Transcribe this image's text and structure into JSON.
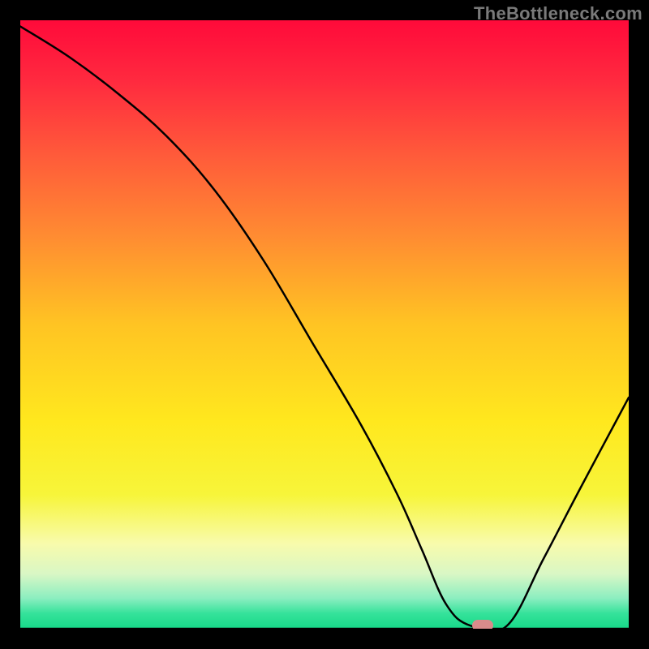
{
  "watermark": "TheBottleneck.com",
  "marker": {
    "color": "#d98b8b"
  },
  "chart_data": {
    "type": "line",
    "title": "",
    "xlabel": "",
    "ylabel": "",
    "xlim": [
      0,
      100
    ],
    "ylim": [
      0,
      100
    ],
    "grid": false,
    "series": [
      {
        "name": "bottleneck-curve",
        "x": [
          0,
          8,
          16,
          24,
          32,
          40,
          48,
          56,
          62,
          66,
          70,
          74,
          80,
          86,
          92,
          100
        ],
        "values": [
          99,
          94,
          88,
          81,
          72,
          60.5,
          47,
          33.5,
          22,
          13,
          4,
          0.5,
          0.5,
          11.5,
          23,
          38
        ]
      }
    ],
    "marker_point": {
      "x": 76,
      "y": 0.5
    },
    "background_gradient": {
      "stops": [
        {
          "offset": 0.0,
          "color": "#ff0a3a"
        },
        {
          "offset": 0.1,
          "color": "#ff2a3f"
        },
        {
          "offset": 0.22,
          "color": "#ff5a3a"
        },
        {
          "offset": 0.35,
          "color": "#ff8a32"
        },
        {
          "offset": 0.5,
          "color": "#ffc423"
        },
        {
          "offset": 0.66,
          "color": "#ffe81e"
        },
        {
          "offset": 0.78,
          "color": "#f7f53a"
        },
        {
          "offset": 0.86,
          "color": "#f8fbac"
        },
        {
          "offset": 0.91,
          "color": "#d9f7c5"
        },
        {
          "offset": 0.95,
          "color": "#8beec0"
        },
        {
          "offset": 0.975,
          "color": "#35e29a"
        },
        {
          "offset": 1.0,
          "color": "#17d989"
        }
      ]
    }
  }
}
